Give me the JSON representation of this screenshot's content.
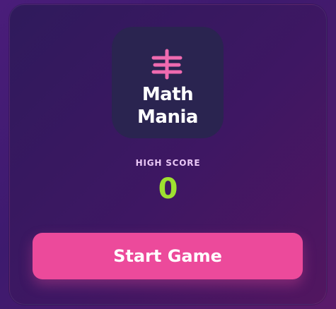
{
  "game": {
    "title_line1": "Math",
    "title_line2": "Mania",
    "logo_icon": "tally-marks-icon",
    "high_score_label": "HIGH SCORE",
    "high_score_value": "0",
    "start_button_label": "Start Game"
  },
  "colors": {
    "accent_pink": "#ec4a9b",
    "score_green": "#9ee030",
    "logo_tile": "#2a2450"
  }
}
